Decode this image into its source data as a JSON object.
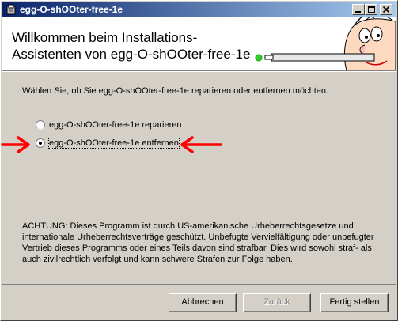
{
  "window": {
    "title": "egg-O-shOOter-free-1e",
    "controls": [
      "minimize",
      "maximize",
      "close"
    ]
  },
  "header": {
    "welcome": "Willkommen beim Installations-\nAssistenten von egg-O-shOOter-free-1e"
  },
  "intro_text": "Wählen Sie, ob Sie egg-O-shOOter-free-1e reparieren oder entfernen möchten.",
  "options": [
    {
      "label": "egg-O-shOOter-free-1e reparieren",
      "selected": false
    },
    {
      "label": "egg-O-shOOter-free-1e entfernen",
      "selected": true
    }
  ],
  "annotation_color": "#ff0000",
  "warning_text": "ACHTUNG: Dieses Programm ist durch US-amerikanische Urheberrechtsgesetze und internationale Urheberrechtsverträge geschützt. Unbefugte Vervielfältigung oder unbefugter Vertrieb dieses Programms oder eines Teils davon sind strafbar. Dies wird sowohl straf- als auch zivilrechtlich verfolgt und kann schwere Strafen zur Folge haben.",
  "buttons": {
    "cancel": "Abbrechen",
    "back": "Zurück",
    "finish": "Fertig stellen"
  }
}
